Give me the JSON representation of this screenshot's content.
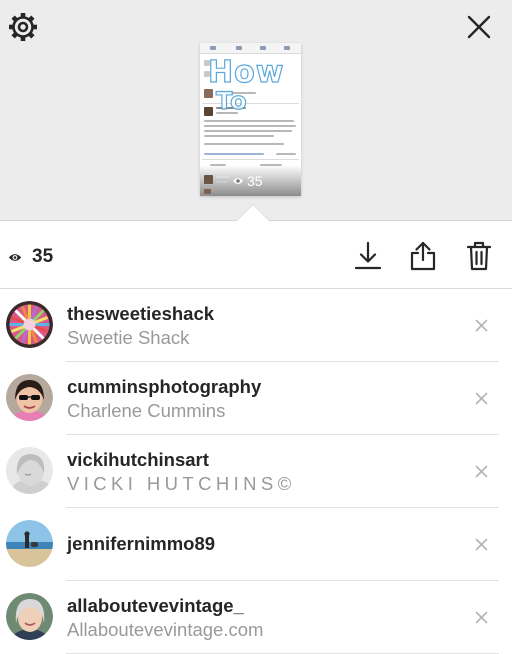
{
  "header": {
    "settings_icon": "gear-icon",
    "close_icon": "close-icon"
  },
  "thumbnail": {
    "overlay_text_line1": "How",
    "overlay_text_line2": "To",
    "view_count": "35",
    "post_author": "Laura Brown",
    "post_body": "Hi everyone! Do you use Instagram stories? I am loving Instagram at the moment & plan to write a guide all about Instagram stories tomorrow!",
    "post_question": "Would love to hear your thoughts beforehand!",
    "comment_author": "Amy White"
  },
  "stats": {
    "eye_icon": "eye-icon",
    "view_count": "35",
    "download_icon": "download-icon",
    "share_icon": "share-icon",
    "delete_icon": "trash-icon"
  },
  "viewers": [
    {
      "username": "thesweetieshack",
      "fullname": "Sweetie Shack"
    },
    {
      "username": "cumminsphotography",
      "fullname": "Charlene Cummins"
    },
    {
      "username": "vickihutchinsart",
      "fullname": "VICKI HUTCHINS©"
    },
    {
      "username": "jennifernimmo89",
      "fullname": ""
    },
    {
      "username": "allaboutevevintage_",
      "fullname": "Allaboutevevintage.com"
    }
  ],
  "colors": {
    "top_background": "#ececec",
    "text_primary": "#262626",
    "text_secondary": "#999999",
    "howto_accent": "#5aa9dc"
  }
}
